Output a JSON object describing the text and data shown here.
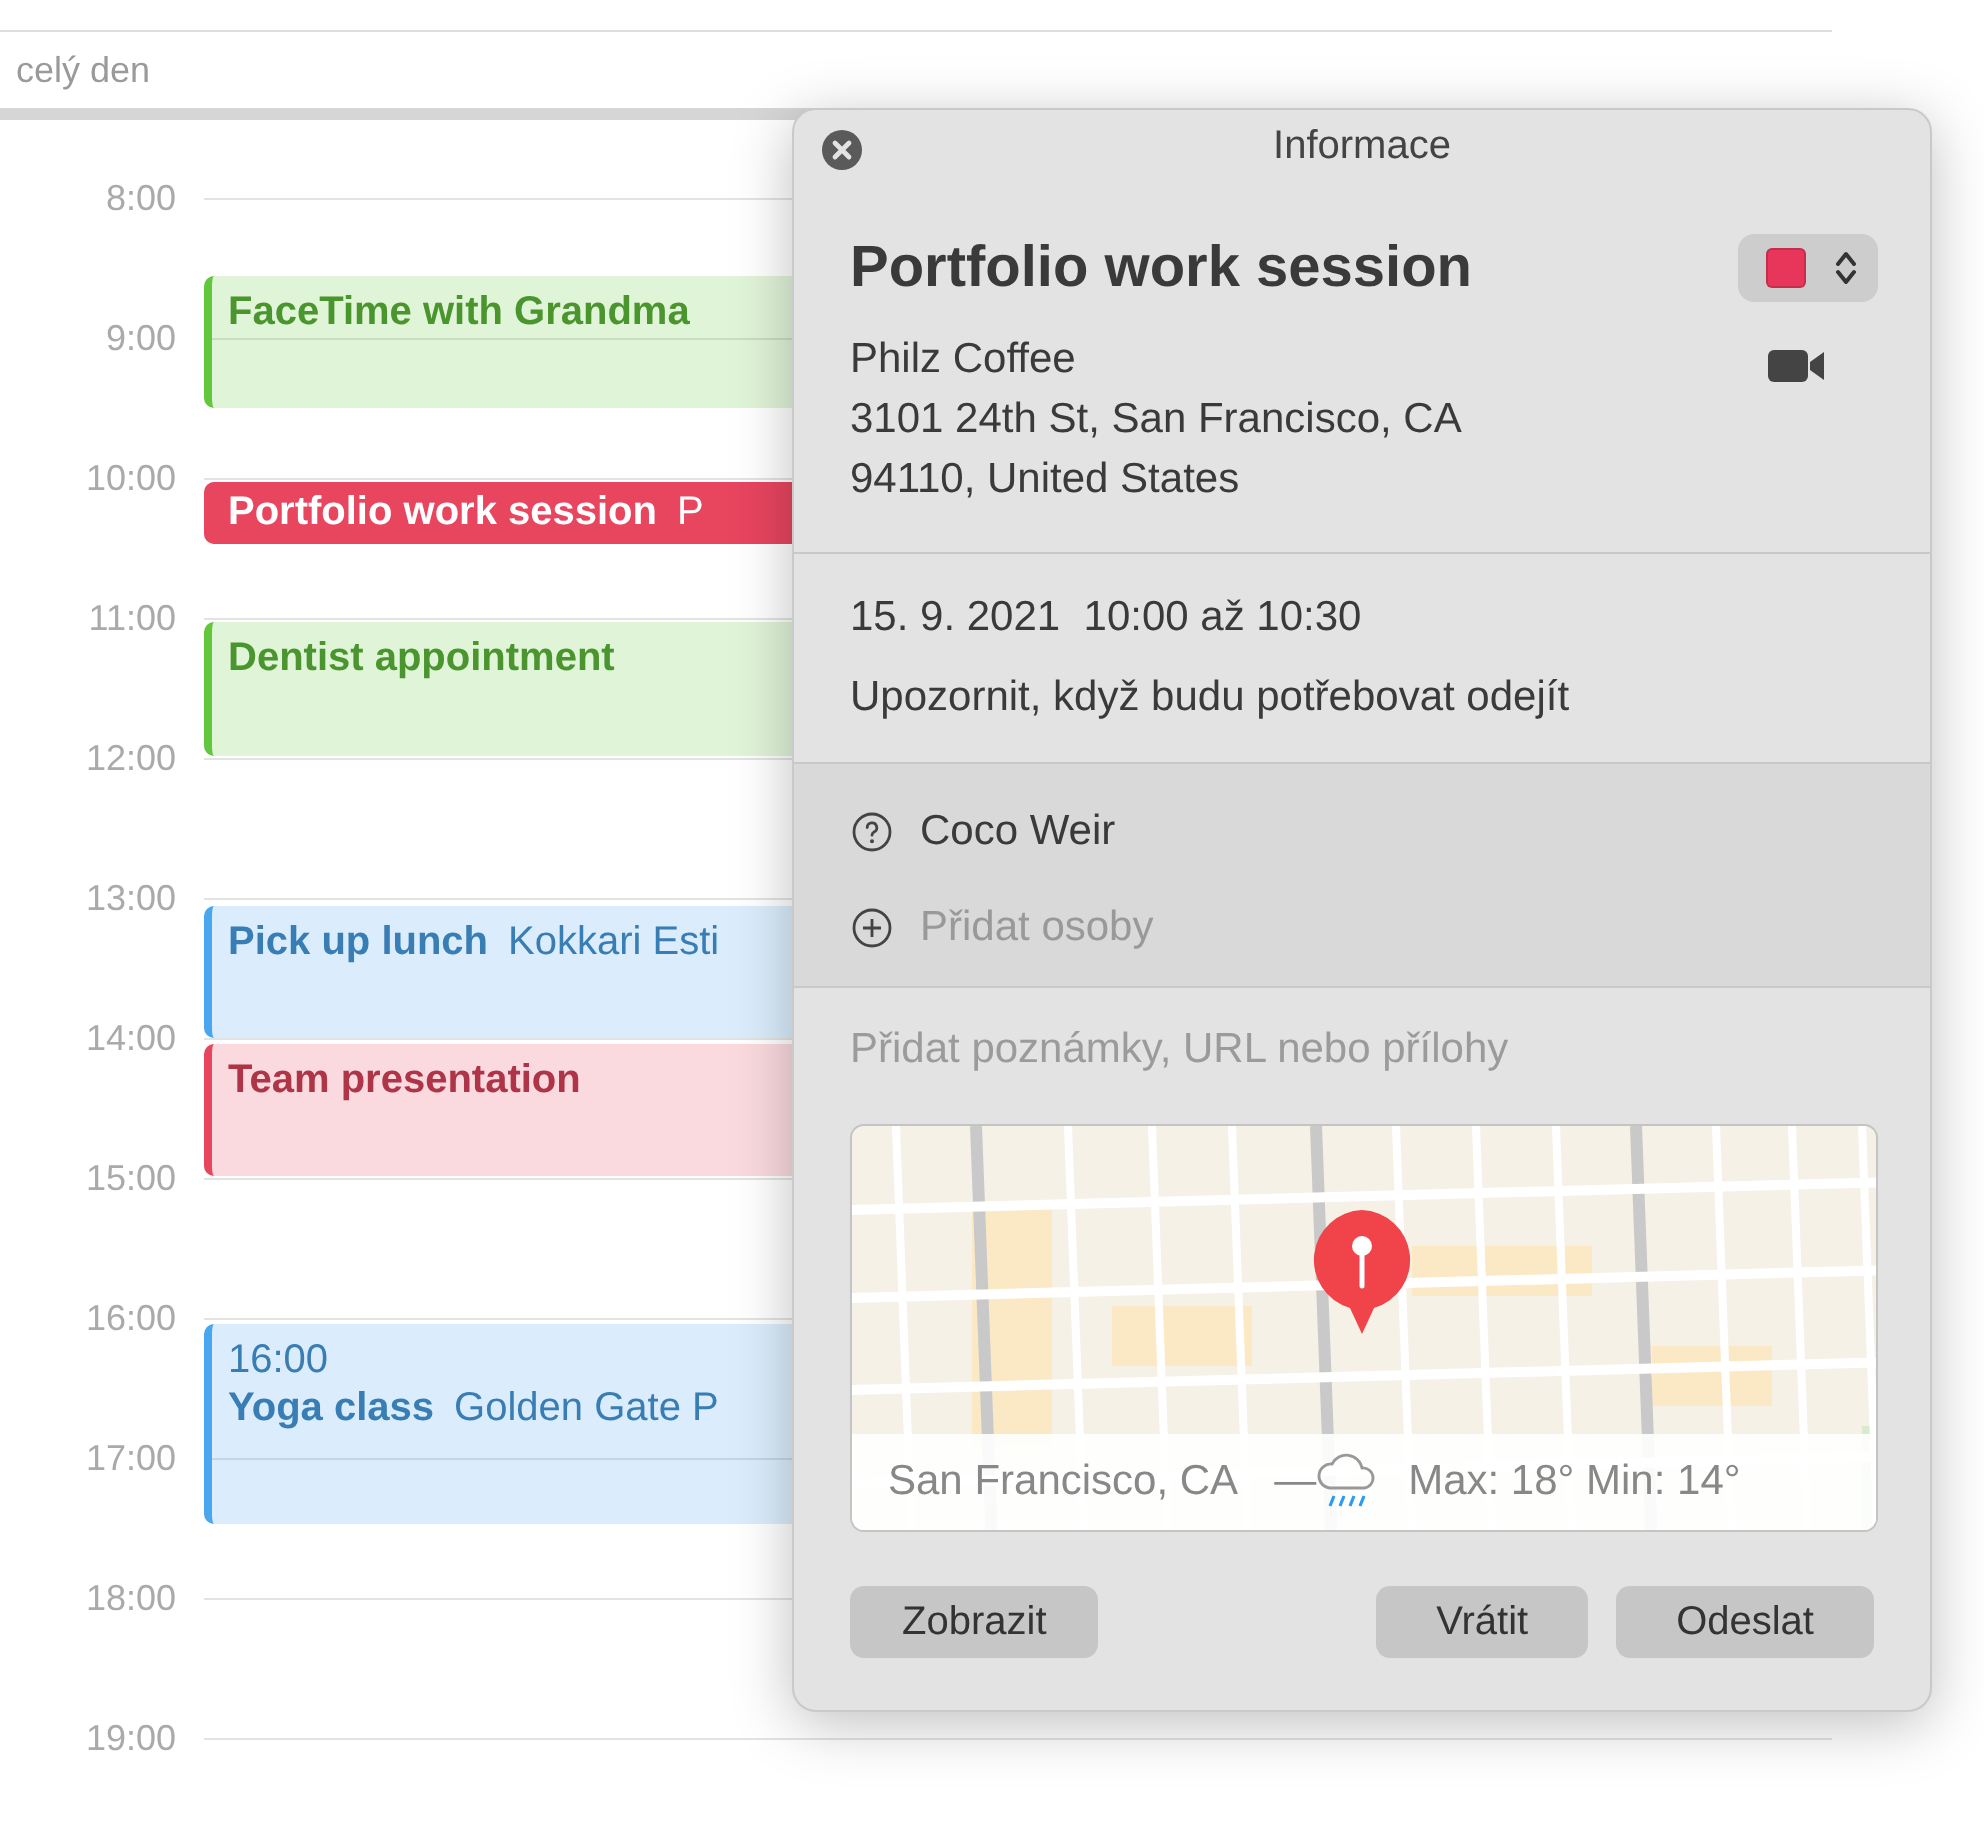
{
  "calendar": {
    "all_day_label": "celý den",
    "hours": [
      "8:00",
      "9:00",
      "10:00",
      "11:00",
      "12:00",
      "13:00",
      "14:00",
      "15:00",
      "16:00",
      "17:00",
      "18:00",
      "19:00"
    ],
    "events": [
      {
        "title": "FaceTime with Grandma",
        "color": "#63c73d",
        "selected": false
      },
      {
        "title": "Portfolio work session",
        "location": "P",
        "color": "#e8455f",
        "selected": true
      },
      {
        "title": "Dentist appointment",
        "color": "#63c73d",
        "selected": false
      },
      {
        "title": "Pick up lunch",
        "location": "Kokkari Esti",
        "color": "#4aa6ee",
        "selected": false
      },
      {
        "title": "Team presentation",
        "color": "#e8455f",
        "selected": false
      },
      {
        "time": "16:00",
        "title": "Yoga class",
        "location": "Golden Gate P",
        "color": "#4aa6ee",
        "selected": false
      }
    ]
  },
  "popover": {
    "title": "Informace",
    "event_title": "Portfolio work session",
    "calendar_picker": {
      "color": "#e8355a"
    },
    "location_lines": [
      "Philz Coffee",
      "3101 24th St, San Francisco, CA",
      "94110, United States"
    ],
    "datetime": "15. 9. 2021  10:00 až 10:30",
    "alert": "Upozornit, když budu potřebovat odejít",
    "attendees": [
      {
        "name": "Coco Weir",
        "kind": "unknown"
      }
    ],
    "add_attendee": "Přidat osoby",
    "notes": {
      "placeholder": "Přidat poznámky, URL nebo přílohy"
    },
    "map": {
      "kind": "picture",
      "weather": {
        "location": "San Francisco, CA",
        "separator": "—",
        "forecast": "Max: 18° Min: 14°"
      }
    },
    "buttons": [
      {
        "label": "Zobrazit",
        "kind": "left"
      },
      {
        "label": "Vrátit",
        "kind": "right"
      },
      {
        "label": "Odeslat",
        "kind": "right"
      }
    ]
  }
}
